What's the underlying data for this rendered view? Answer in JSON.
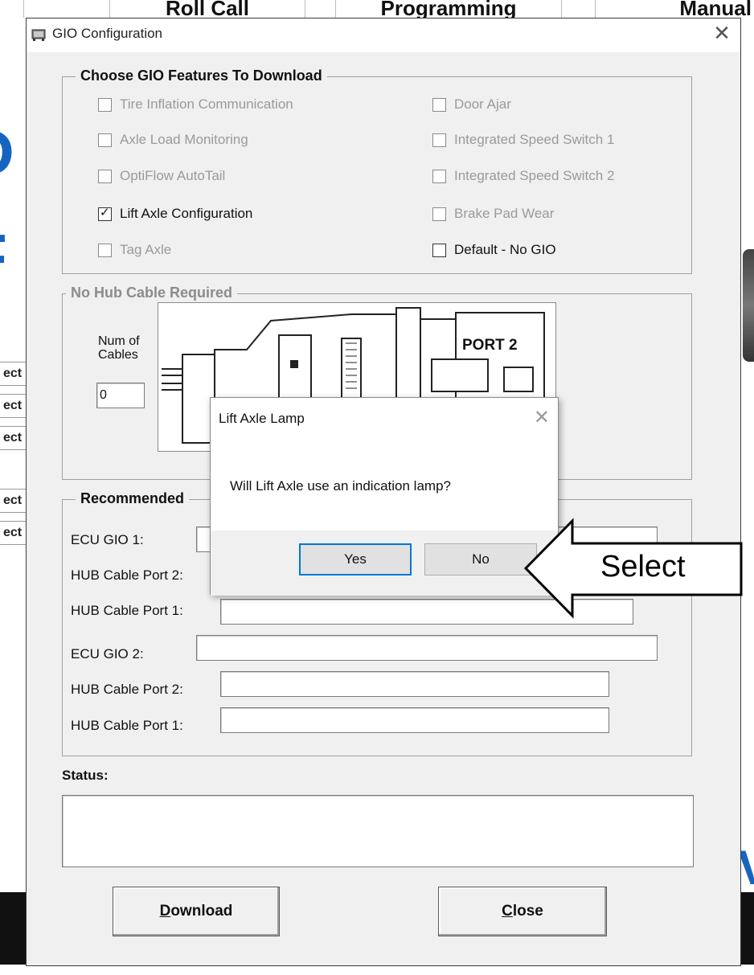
{
  "background_app": {
    "tabs": [
      "Roll Call",
      "Programming",
      "Manual"
    ],
    "side_items": [
      "ect",
      "ect",
      "ect",
      "ect",
      "ect"
    ]
  },
  "window": {
    "title": "GIO Configuration",
    "close_glyph": "✕"
  },
  "features_group": {
    "title": "Choose GIO Features To Download",
    "items": [
      {
        "label": "Tire Inflation Communication",
        "checked": false,
        "enabled": false
      },
      {
        "label": "Axle Load Monitoring",
        "checked": false,
        "enabled": false
      },
      {
        "label": "OptiFlow AutoTail",
        "checked": false,
        "enabled": false
      },
      {
        "label": "Lift Axle Configuration",
        "checked": true,
        "enabled": true
      },
      {
        "label": "Tag Axle",
        "checked": false,
        "enabled": false
      },
      {
        "label": "Door Ajar",
        "checked": false,
        "enabled": false
      },
      {
        "label": "Integrated Speed Switch 1",
        "checked": false,
        "enabled": false
      },
      {
        "label": "Integrated Speed Switch 2",
        "checked": false,
        "enabled": false
      },
      {
        "label": "Brake Pad Wear",
        "checked": false,
        "enabled": false
      },
      {
        "label": "Default - No GIO",
        "checked": false,
        "enabled": true
      }
    ]
  },
  "hub_group": {
    "title": "No Hub Cable Required",
    "num_cables_label": "Num of\nCables",
    "num_cables_value": "0",
    "diagram_label": "PORT 2"
  },
  "recommended_group": {
    "title": "Recommended",
    "fields": [
      {
        "label": "ECU GIO 1:",
        "value": ""
      },
      {
        "label": "HUB Cable Port 2:",
        "value": ""
      },
      {
        "label": "HUB Cable Port 1:",
        "value": ""
      },
      {
        "label": "ECU GIO 2:",
        "value": ""
      },
      {
        "label": "HUB Cable Port 2:",
        "value": ""
      },
      {
        "label": "HUB Cable Port 1:",
        "value": ""
      }
    ]
  },
  "status": {
    "label": "Status:",
    "value": ""
  },
  "buttons": {
    "download_label": "Download",
    "close_label": "Close"
  },
  "message_box": {
    "title": "Lift Axle Lamp",
    "message": "Will Lift Axle use an indication lamp?",
    "yes_label": "Yes",
    "no_label": "No",
    "close_glyph": "✕"
  },
  "callout": {
    "text": "Select"
  },
  "colors": {
    "dialog_bg": "#f0f0f0",
    "default_button_border": "#0078d7",
    "disabled_text": "#9a9a9a"
  }
}
